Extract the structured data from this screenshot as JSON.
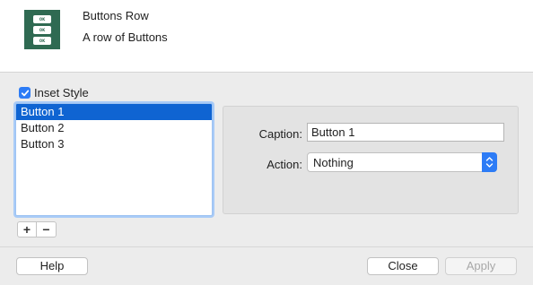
{
  "header": {
    "title": "Buttons Row",
    "subtitle": "A row of Buttons",
    "icon_button_label": "OK"
  },
  "inset_style": {
    "label": "Inset Style",
    "checked": true
  },
  "buttons_list": {
    "items": [
      "Button 1",
      "Button 2",
      "Button 3"
    ],
    "selected_index": 0
  },
  "list_controls": {
    "add_label": "+",
    "remove_label": "−"
  },
  "detail": {
    "caption_label": "Caption:",
    "caption_value": "Button 1",
    "action_label": "Action:",
    "action_value": "Nothing"
  },
  "footer": {
    "help_label": "Help",
    "close_label": "Close",
    "apply_label": "Apply",
    "apply_enabled": false
  },
  "colors": {
    "accent": "#2d7cf6",
    "selection": "#0f64d2",
    "icon_background": "#2f6a52"
  }
}
